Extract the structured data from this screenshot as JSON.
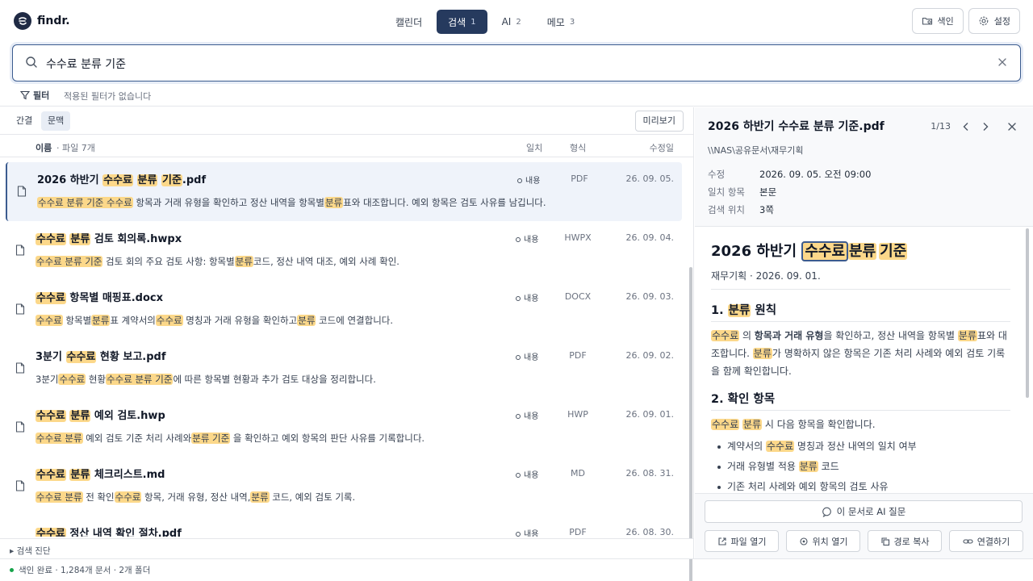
{
  "app": {
    "name": "findr."
  },
  "tabs": [
    {
      "label": "캘린더",
      "badge": ""
    },
    {
      "label": "검색",
      "badge": "1"
    },
    {
      "label": "AI",
      "badge": "2"
    },
    {
      "label": "메모",
      "badge": "3"
    }
  ],
  "top_actions": {
    "index_label": "색인",
    "settings_label": "설정"
  },
  "search": {
    "query": "수수료 분류 기준"
  },
  "filter": {
    "label": "필터",
    "note": "적용된 필터가 없습니다"
  },
  "view": {
    "compact": "간결",
    "context": "문맥",
    "preview": "미리보기"
  },
  "columns": {
    "name": "이름",
    "count": "· 파일 7개",
    "match": "일치",
    "format": "형식",
    "modified": "수정일"
  },
  "results": [
    {
      "name_parts": [
        {
          "t": "2026 하반기 ",
          "h": false
        },
        {
          "t": "수수료",
          "h": true
        },
        {
          "t": " ",
          "h": false
        },
        {
          "t": "분류",
          "h": true
        },
        {
          "t": " ",
          "h": false
        },
        {
          "t": "기준",
          "h": true
        },
        {
          "t": ".pdf",
          "h": false
        }
      ],
      "snippet_parts": [
        {
          "t": "수수료 분류 기준 수수료",
          "h": true
        },
        {
          "t": " 항목과 거래 유형을 확인하고 정산 내역을 항목별",
          "h": false
        },
        {
          "t": "분류",
          "h": true
        },
        {
          "t": "표와 대조합니다. 예외 항목은 검토 사유를 남깁니다.",
          "h": false
        }
      ],
      "match": "내용",
      "format": "PDF",
      "date": "26. 09. 05.",
      "selected": true
    },
    {
      "name_parts": [
        {
          "t": "수수료",
          "h": true
        },
        {
          "t": " ",
          "h": false
        },
        {
          "t": "분류",
          "h": true
        },
        {
          "t": " 검토 회의록.hwpx",
          "h": false
        }
      ],
      "snippet_parts": [
        {
          "t": "수수료 분류 기준",
          "h": true
        },
        {
          "t": " 검토 회의 주요 검토 사항: 항목별",
          "h": false
        },
        {
          "t": "분류",
          "h": true
        },
        {
          "t": "코드, 정산 내역 대조, 예외 사례 확인.",
          "h": false
        }
      ],
      "match": "내용",
      "format": "HWPX",
      "date": "26. 09. 04.",
      "selected": false
    },
    {
      "name_parts": [
        {
          "t": "수수료",
          "h": true
        },
        {
          "t": " 항목별 매핑표.docx",
          "h": false
        }
      ],
      "snippet_parts": [
        {
          "t": "수수료",
          "h": true
        },
        {
          "t": " 항목별",
          "h": false
        },
        {
          "t": "분류",
          "h": true
        },
        {
          "t": "표 계약서의",
          "h": false
        },
        {
          "t": "수수료",
          "h": true
        },
        {
          "t": " 명칭과 거래 유형을 확인하고",
          "h": false
        },
        {
          "t": "분류",
          "h": true
        },
        {
          "t": " 코드에 연결합니다.",
          "h": false
        }
      ],
      "match": "내용",
      "format": "DOCX",
      "date": "26. 09. 03.",
      "selected": false
    },
    {
      "name_parts": [
        {
          "t": "3분기 ",
          "h": false
        },
        {
          "t": "수수료",
          "h": true
        },
        {
          "t": " 현황 보고.pdf",
          "h": false
        }
      ],
      "snippet_parts": [
        {
          "t": "3분기",
          "h": false
        },
        {
          "t": "수수료",
          "h": true
        },
        {
          "t": " 현황",
          "h": false
        },
        {
          "t": "수수료 분류 기준",
          "h": true
        },
        {
          "t": "에 따른 항목별 현황과 추가 검토 대상을 정리합니다.",
          "h": false
        }
      ],
      "match": "내용",
      "format": "PDF",
      "date": "26. 09. 02.",
      "selected": false
    },
    {
      "name_parts": [
        {
          "t": "수수료",
          "h": true
        },
        {
          "t": " ",
          "h": false
        },
        {
          "t": "분류",
          "h": true
        },
        {
          "t": " 예외 검토.hwp",
          "h": false
        }
      ],
      "snippet_parts": [
        {
          "t": "수수료 분류",
          "h": true
        },
        {
          "t": " 예외 검토 기준 처리 사례와",
          "h": false
        },
        {
          "t": "분류 기준",
          "h": true
        },
        {
          "t": " 을 확인하고 예외 항목의 판단 사유를 기록합니다.",
          "h": false
        }
      ],
      "match": "내용",
      "format": "HWP",
      "date": "26. 09. 01.",
      "selected": false
    },
    {
      "name_parts": [
        {
          "t": "수수료",
          "h": true
        },
        {
          "t": " ",
          "h": false
        },
        {
          "t": "분류",
          "h": true
        },
        {
          "t": " 체크리스트.md",
          "h": false
        }
      ],
      "snippet_parts": [
        {
          "t": "수수료 분류",
          "h": true
        },
        {
          "t": " 전 확인",
          "h": false
        },
        {
          "t": "수수료",
          "h": true
        },
        {
          "t": " 항목, 거래 유형, 정산 내역,",
          "h": false
        },
        {
          "t": "분류",
          "h": true
        },
        {
          "t": " 코드, 예외 검토 기록.",
          "h": false
        }
      ],
      "match": "내용",
      "format": "MD",
      "date": "26. 08. 31.",
      "selected": false
    },
    {
      "name_parts": [
        {
          "t": "수수료",
          "h": true
        },
        {
          "t": " 정산 내역 확인 절차.pdf",
          "h": false
        }
      ],
      "snippet_parts": [],
      "match": "내용",
      "format": "PDF",
      "date": "26. 08. 30.",
      "selected": false
    }
  ],
  "diagnostics_label": "▸ 검색 진단",
  "preview": {
    "title": "2026 하반기 수수료 분류 기준.pdf",
    "pager": "1/13",
    "path": "\\\\NAS\\공유문서\\재무기획",
    "meta": [
      {
        "key": "수정",
        "value": "2026. 09. 05. 오전 09:00"
      },
      {
        "key": "일치 항목",
        "value": "본문"
      },
      {
        "key": "검색 위치",
        "value": "3쪽"
      }
    ],
    "doc": {
      "h1_prefix": "2026 하반기",
      "h1_terms": [
        "수수료",
        "분류",
        "기준"
      ],
      "subtitle": "재무기획 · 2026. 09. 01.",
      "sec1_title_num": "1.",
      "sec1_title_term": "분류",
      "sec1_title_rest": "원칙",
      "sec1_p": [
        {
          "t": "수수료",
          "h": true
        },
        {
          "t": " 의 ",
          "h": false
        },
        {
          "t": "항목과 거래 유형",
          "h": false,
          "b": true
        },
        {
          "t": "을 확인하고, 정산 내역을 항목별 ",
          "h": false
        },
        {
          "t": "분류",
          "h": true
        },
        {
          "t": "표와 대조합니다. ",
          "h": false
        },
        {
          "t": "분류",
          "h": true
        },
        {
          "t": "가 명확하지 않은 항목은 기존 처리 사례와 예외 검토 기록을 함께 확인합니다.",
          "h": false
        }
      ],
      "sec2_title": "2. 확인 항목",
      "sec2_p": [
        {
          "t": "수수료",
          "h": true
        },
        {
          "t": " ",
          "h": false
        },
        {
          "t": "분류",
          "h": true
        },
        {
          "t": " 시 다음 항목을 확인합니다.",
          "h": false
        }
      ],
      "bullets": [
        [
          {
            "t": "계약서의 ",
            "h": false
          },
          {
            "t": "수수료",
            "h": true
          },
          {
            "t": " 명칭과 정산 내역의 일치 여부",
            "h": false
          }
        ],
        [
          {
            "t": "거래 유형별 적용 ",
            "h": false
          },
          {
            "t": "분류",
            "h": true
          },
          {
            "t": " 코드",
            "h": false
          }
        ],
        [
          {
            "t": "기존 처리 사례와 예외 항목의 검토 사유",
            "h": false
          }
        ]
      ]
    },
    "ai_button": "이 문서로 AI 질문",
    "actions": [
      "파일 열기",
      "위치 열기",
      "경로 복사",
      "연결하기"
    ]
  },
  "status": "색인 완료 · 1,284개 문서 · 2개 폴더"
}
